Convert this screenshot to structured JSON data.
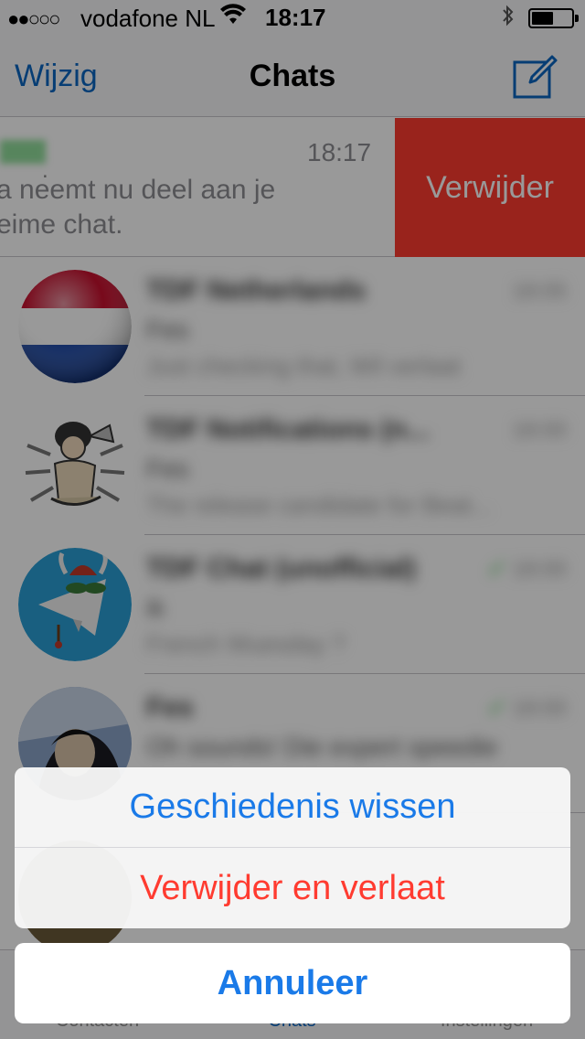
{
  "status_bar": {
    "signal": "●●○○○",
    "carrier": "vodafone NL",
    "wifi": "wifi-icon",
    "time": "18:17",
    "bluetooth": "bluetooth-icon",
    "battery_level": 0.55
  },
  "nav": {
    "edit_label": "Wijzig",
    "title": "Chats",
    "compose_icon": "compose-icon"
  },
  "swiped_chat": {
    "time": "18:17",
    "message_line1": "a neemt nu deel aan je",
    "message_line2": "eime chat.",
    "delete_label": "Verwijder",
    "delete_color": "#ff3b30"
  },
  "chats": [
    {
      "title": "TDF Netherlands",
      "line2": "Fes",
      "line3": "Just checking that, Wil verlaat",
      "time": "18:05"
    },
    {
      "title": "TDF Notifications (n...",
      "line2": "Fes",
      "line3": "The release candidate for Beat...",
      "time": "18:00"
    },
    {
      "title": "TDF Chat (unofficial)",
      "line2": "ik",
      "line3": "French Wuesday ?",
      "time": "18:00"
    },
    {
      "title": "Fes",
      "line2": "Oh sounds! Die expert speedie",
      "line3": "",
      "time": "18:00"
    }
  ],
  "tabs": [
    {
      "label": "Contacten"
    },
    {
      "label": "Chats"
    },
    {
      "label": "Instellingen"
    }
  ],
  "action_sheet": {
    "clear_history_label": "Geschiedenis wissen",
    "delete_leave_label": "Verwijder en verlaat",
    "cancel_label": "Annuleer",
    "accent_color": "#1a7ae8",
    "destructive_color": "#ff3b30"
  }
}
